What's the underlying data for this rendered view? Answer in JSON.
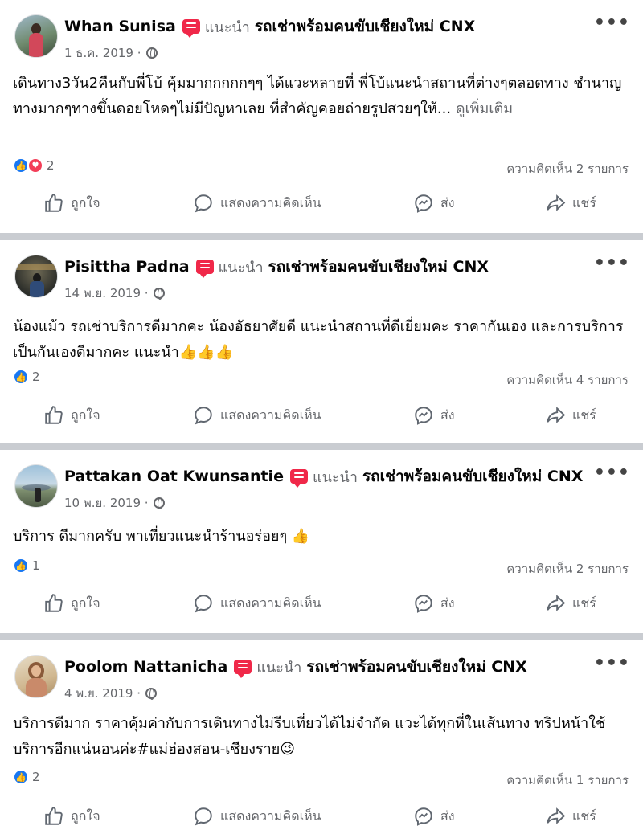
{
  "page_name": "รถเช่าพร้อมคนขับเชียงใหม่ CNX",
  "recommend_word": "แนะนำ",
  "more_label": "•••",
  "actions": {
    "like": "ถูกใจ",
    "comment": "แสดงความคิดเห็น",
    "send": "ส่ง",
    "share": "แชร์"
  },
  "posts": [
    {
      "author": "Whan Sunisa",
      "date": "1 ธ.ค. 2019 ·",
      "text": "เดินทาง3วัน2คืนกับพี่โบ้ คุ้มมากกกกกๆๆ ได้แวะหลายที่ พี่โบ้แนะนำสถานที่ต่างๆตลอดทาง ชำนาญทางมากๆทางขึ้นดอยโหดๆไม่มีปัญหาเลย ที่สำคัญคอยถ่ายรูปสวยๆให้...",
      "see_more": "ดูเพิ่มเติม",
      "reaction_count": "2",
      "comments": "ความคิดเห็น 2 รายการ"
    },
    {
      "author": "Pisittha Padna",
      "date": "14 พ.ย. 2019 ·",
      "text": "น้องแม้ว รถเช่าบริการดีมากคะ น้องอัธยาศัยดี แนะนำสถานที่ดีเยี่ยมคะ ราคากันเอง และการบริการเป็นกันเองดีมากคะ แนะนำ👍👍👍",
      "reaction_count": "2",
      "comments": "ความคิดเห็น 4 รายการ"
    },
    {
      "author": "Pattakan Oat Kwunsantie",
      "date": "10 พ.ย. 2019 ·",
      "text": "บริการ ดีมากครับ พาเที่ยวแนะนำร้านอร่อยๆ 👍",
      "reaction_count": "1",
      "comments": "ความคิดเห็น 2 รายการ"
    },
    {
      "author": "Poolom Nattanicha",
      "date": "4 พ.ย. 2019 ·",
      "text": "บริการดีมาก ราคาคุ้มค่ากับการเดินทางไม่รีบเที่ยวได้ไม่จำกัด แวะได้ทุกที่ในเส้นทาง ทริปหน้าใช้บริการอีกแน่นอนค่ะ#แม่ฮ่องสอน-เชียงราย😉",
      "reaction_count": "2",
      "comments": "ความคิดเห็น 1 รายการ"
    }
  ]
}
